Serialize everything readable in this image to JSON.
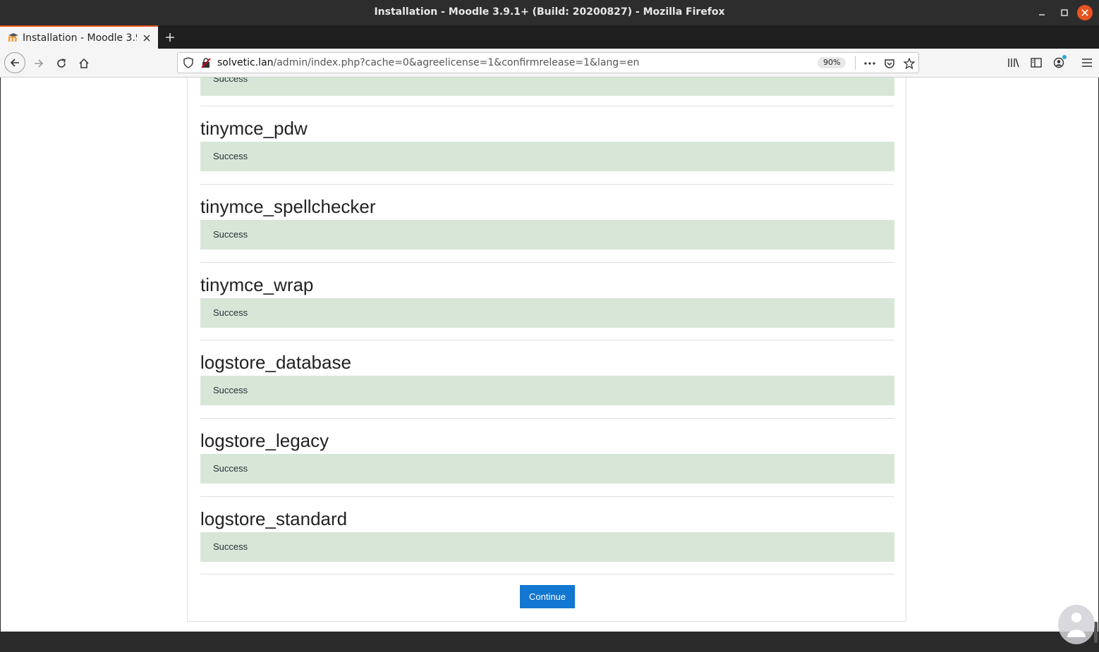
{
  "window": {
    "title": "Installation - Moodle 3.9.1+ (Build: 20200827) - Mozilla Firefox"
  },
  "tab": {
    "title": "Installation - Moodle 3.9.1+ (Build: 20200827)",
    "favicon": "moodle-icon"
  },
  "address": {
    "host": "solvetic.lan",
    "path": "/admin/index.php?cache=0&agreelicense=1&confirmrelease=1&lang=en",
    "zoom": "90%"
  },
  "page": {
    "top_status": "Success",
    "sections": [
      {
        "name": "tinymce_pdw",
        "status": "Success"
      },
      {
        "name": "tinymce_spellchecker",
        "status": "Success"
      },
      {
        "name": "tinymce_wrap",
        "status": "Success"
      },
      {
        "name": "logstore_database",
        "status": "Success"
      },
      {
        "name": "logstore_legacy",
        "status": "Success"
      },
      {
        "name": "logstore_standard",
        "status": "Success"
      }
    ],
    "continue_label": "Continue"
  },
  "colors": {
    "success_bg": "#d8e6d8",
    "primary": "#1177d1",
    "ubuntu_orange": "#e95420"
  }
}
